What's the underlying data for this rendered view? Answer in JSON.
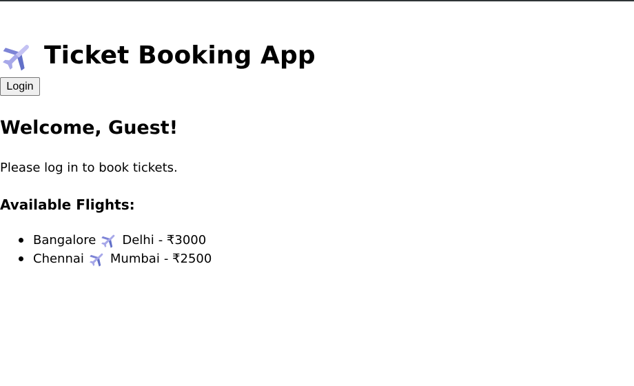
{
  "app": {
    "title": "Ticket Booking App",
    "icon": "airplane-icon"
  },
  "auth": {
    "login_label": "Login"
  },
  "main": {
    "welcome": "Welcome, Guest!",
    "login_message": "Please log in to book tickets.",
    "flights_heading": "Available Flights:"
  },
  "flights": [
    {
      "from": "Bangalore",
      "to": "Delhi",
      "price": "- ₹3000"
    },
    {
      "from": "Chennai",
      "to": "Mumbai",
      "price": "- ₹2500"
    }
  ],
  "colors": {
    "page_background": "#ffffff",
    "top_border": "#2f3436",
    "text": "#000000",
    "button_background": "#efefef",
    "button_border": "#767676",
    "plane_body": "#a7a8e9",
    "plane_shadow": "#6270c8"
  }
}
